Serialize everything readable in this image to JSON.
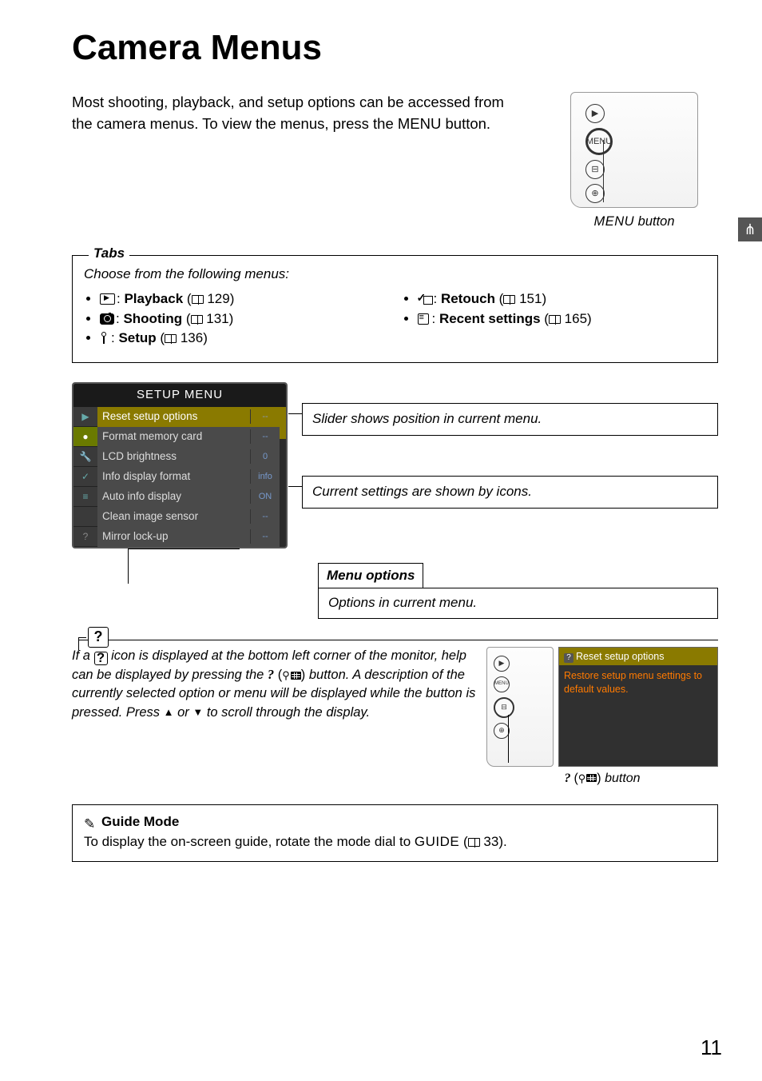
{
  "title": "Camera Menus",
  "intro": "Most shooting, playback, and setup options can be accessed from the camera menus. To view the menus, press the MENU button.",
  "intro_btn_word": "MENU",
  "intro_caption_pre": "MENU",
  "intro_caption_post": " button",
  "side_tab": "⋔",
  "tabs": {
    "label": "Tabs",
    "lead": "Choose from the following menus:",
    "left": [
      {
        "name": "Playback",
        "page": "129"
      },
      {
        "name": "Shooting",
        "page": "131"
      },
      {
        "name": "Setup",
        "page": "136"
      }
    ],
    "right": [
      {
        "name": "Retouch",
        "page": "151"
      },
      {
        "name": "Recent settings",
        "page": "165"
      }
    ]
  },
  "lcd": {
    "header": "SETUP MENU",
    "tabs": [
      "▶",
      "●",
      "🔧",
      "✓",
      "≡",
      "",
      "?"
    ],
    "rows": [
      {
        "t": "Reset setup options",
        "v": "--",
        "sel": true
      },
      {
        "t": "Format memory card",
        "v": "--"
      },
      {
        "t": "LCD brightness",
        "v": "0"
      },
      {
        "t": "Info display format",
        "v": "info"
      },
      {
        "t": "Auto info display",
        "v": "ON"
      },
      {
        "t": "Clean image sensor",
        "v": "--"
      },
      {
        "t": "Mirror lock-up",
        "v": "--"
      }
    ]
  },
  "callout1": "Slider shows position in current menu.",
  "callout2": "Current settings are shown by icons.",
  "menu_options": {
    "title": "Menu options",
    "body": "Options in current menu."
  },
  "help": {
    "q": "?",
    "text_parts": {
      "a": "If a ",
      "b": " icon is displayed at the bottom left corner of the monitor, help can be displayed by pressing the ",
      "c": " button. A description of the currently selected option or menu will be displayed while the button is pressed. Press ",
      "d": " or ",
      "e": " to scroll through the display."
    },
    "tooltip_head": "Reset setup options",
    "tooltip_body": "Restore setup menu settings to default values.",
    "caption_pre": "? ",
    "caption_post": " button"
  },
  "guide": {
    "title": "Guide Mode",
    "body_pre": "To display the on-screen guide, rotate the mode dial to ",
    "body_mid": "GUIDE",
    "body_post": " (",
    "page": "33",
    "body_end": ")."
  },
  "pagenum": "11"
}
